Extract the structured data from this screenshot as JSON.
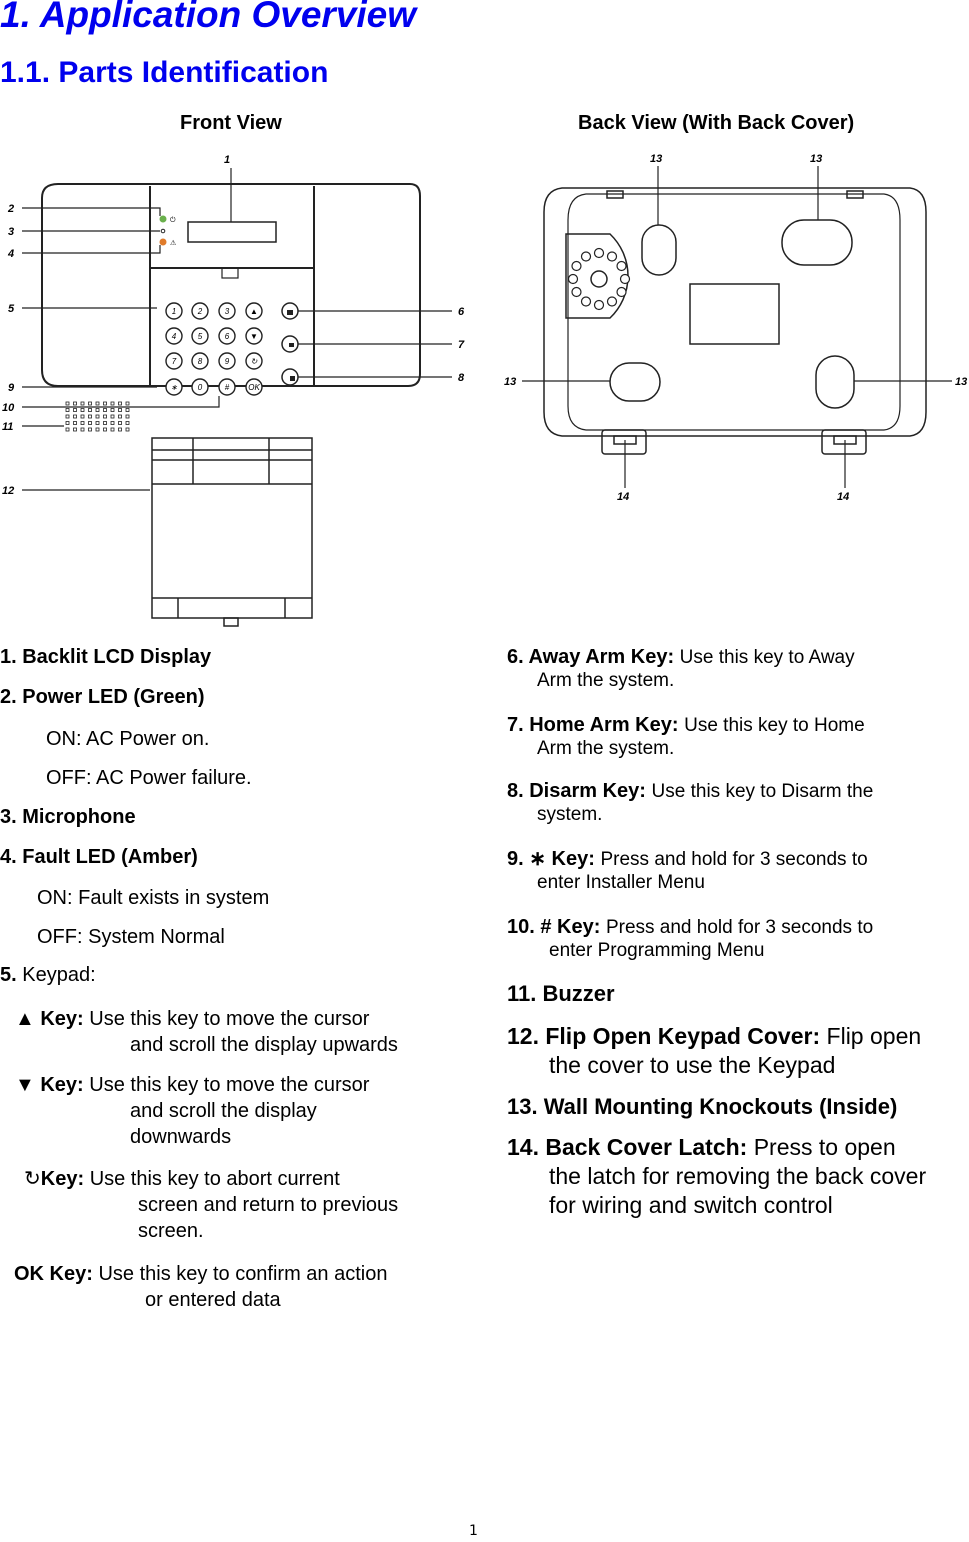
{
  "heading": {
    "chapter": "1. Application Overview",
    "section": "1.1. Parts Identification"
  },
  "figures": {
    "front": {
      "caption": "Front View",
      "callouts": [
        "1",
        "2",
        "3",
        "4",
        "5",
        "6",
        "7",
        "8",
        "9",
        "10",
        "11",
        "12"
      ],
      "keypad_keys": [
        "1",
        "2",
        "3",
        "▲",
        "4",
        "5",
        "6",
        "▼",
        "7",
        "8",
        "9",
        "↻",
        "∗",
        "0",
        "#",
        "OK"
      ],
      "led_colors": {
        "power": "#6ab04c",
        "fault": "#e07b2a"
      }
    },
    "back": {
      "caption": "Back View (With Back Cover)",
      "callouts": [
        "13",
        "13",
        "13",
        "13",
        "14",
        "14"
      ]
    }
  },
  "parts_left": [
    {
      "title": "1. Backlit LCD Display"
    },
    {
      "title": "2. Power LED (Green)",
      "states": [
        "ON: AC Power on.",
        "OFF: AC Power failure."
      ]
    },
    {
      "title": "3. Microphone"
    },
    {
      "title": "4. Fault LED (Amber)",
      "states": [
        "ON: Fault exists in system",
        "OFF: System Normal"
      ]
    },
    {
      "num": "5.",
      "title": "Keypad:"
    }
  ],
  "keypad_keys_desc": [
    {
      "icon": "▲",
      "label": "Key:",
      "line1": "Use this key to move the cursor",
      "rest": [
        "and scroll the display upwards"
      ]
    },
    {
      "icon": "▼",
      "label": "Key:",
      "line1": "Use this key to move the cursor",
      "rest": [
        "and scroll the display",
        "downwards"
      ]
    },
    {
      "icon": "↻",
      "label": "Key:",
      "line1": "Use this key to abort current",
      "rest": [
        "screen and return to previous",
        "screen."
      ]
    },
    {
      "icon": "",
      "label": "OK Key:",
      "line1": "Use this key to confirm an action",
      "rest": [
        "or entered data"
      ]
    }
  ],
  "parts_right": [
    {
      "label": "6. Away Arm Key:",
      "line1": "Use this key to Away",
      "rest": [
        "Arm the system."
      ]
    },
    {
      "label": "7. Home Arm Key:",
      "line1": "Use this key to Home",
      "rest": [
        "Arm the system."
      ]
    },
    {
      "label": "8. Disarm Key:",
      "line1": "Use this key to Disarm the",
      "rest": [
        "system."
      ]
    },
    {
      "label": "9. ∗ Key:",
      "line1": "Press and hold for 3 seconds to",
      "rest": [
        "enter Installer Menu"
      ]
    },
    {
      "label": "10. # Key:",
      "line1": "Press and hold for 3 seconds to",
      "rest": [
        "enter Programming Menu"
      ]
    },
    {
      "label": "11. Buzzer",
      "line1": "",
      "rest": []
    },
    {
      "label": "12. Flip Open Keypad Cover:",
      "line1": "Flip open",
      "rest": [
        "the cover to use the Keypad"
      ]
    },
    {
      "label": "13. Wall Mounting Knockouts (Inside)",
      "line1": "",
      "rest": []
    },
    {
      "label": "14. Back Cover Latch:",
      "line1": "Press to open",
      "rest": [
        "the latch for removing the back cover",
        "for wiring and switch control"
      ]
    }
  ],
  "footer": {
    "page_number": "1"
  }
}
